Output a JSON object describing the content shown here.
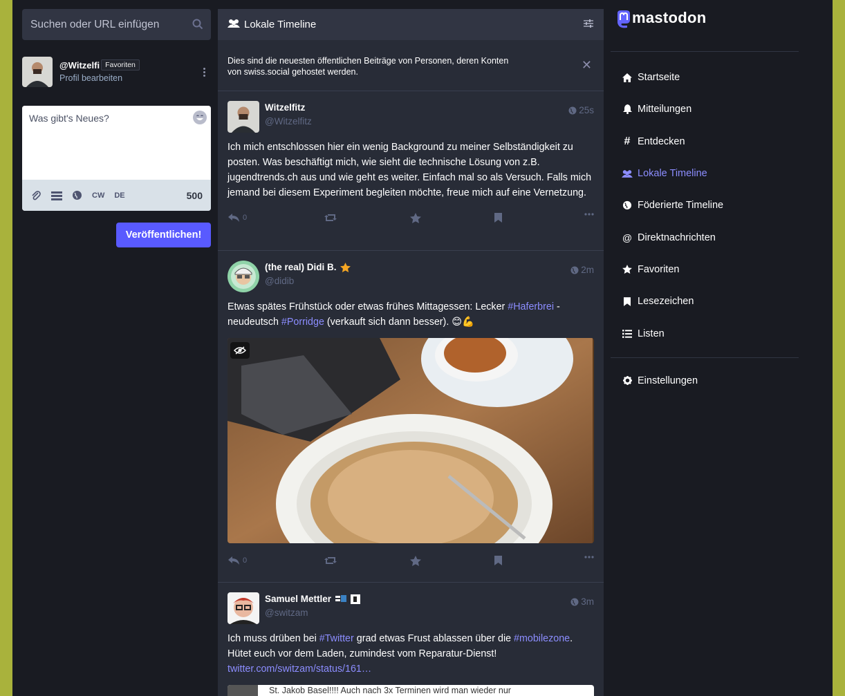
{
  "search": {
    "placeholder": "Suchen oder URL einfügen"
  },
  "profile": {
    "handle": "@Witzelfi",
    "tooltip": "Favoriten",
    "edit_label": "Profil bearbeiten"
  },
  "composer": {
    "placeholder": "Was gibt's Neues?",
    "cw_label": "CW",
    "lang_label": "DE",
    "char_count": "500",
    "publish_label": "Veröffentlichen!"
  },
  "column": {
    "title": "Lokale Timeline",
    "banner_line1": "Dies sind die neuesten öffentlichen Beiträge von Personen, deren Konten",
    "banner_line2": "von swiss.social gehostet werden."
  },
  "posts": [
    {
      "display_name": "Witzelfitz",
      "acct": "@Witzelfitz",
      "time": "25s",
      "text": "Ich mich entschlossen hier ein wenig Background zu meiner Selbständigkeit zu posten. Was beschäftigt mich, wie sieht die technische Lösung von z.B. jugendtrends.ch aus und wie geht es weiter. Einfach mal so als Versuch. Falls mich jemand bei diesem Experiment begleiten möchte, freue mich auf eine Vernetzung.",
      "replies": "0"
    },
    {
      "display_name": "(the real) Didi B.",
      "acct": "@didib",
      "time": "2m",
      "text_a": "Etwas spätes Frühstück oder etwas frühes Mittagessen: Lecker ",
      "tag1": "#Haferbrei",
      "text_b": " - neudeutsch ",
      "tag2": "#Porridge",
      "text_c": " (verkauft sich dann besser). 😊💪",
      "replies": "0"
    },
    {
      "display_name": "Samuel Mettler",
      "acct": "@switzam",
      "time": "3m",
      "text_a": "Ich muss drüben bei ",
      "tag1": "#Twitter",
      "text_b": " grad etwas Frust ablassen über die ",
      "tag2": "#mobilezone",
      "text_c": ". Hütet euch vor dem Laden, zumindest vom Reparatur-Dienst!",
      "link": "twitter.com/switzam/status/161…",
      "preview_text": "St. Jakob Basel!!!! Auch nach 3x Terminen wird man wieder nur"
    }
  ],
  "brand": {
    "logo_text": "mastodon"
  },
  "nav": [
    {
      "label": "Startseite"
    },
    {
      "label": "Mitteilungen"
    },
    {
      "label": "Entdecken"
    },
    {
      "label": "Lokale Timeline"
    },
    {
      "label": "Föderierte Timeline"
    },
    {
      "label": "Direktnachrichten"
    },
    {
      "label": "Favoriten"
    },
    {
      "label": "Lesezeichen"
    },
    {
      "label": "Listen"
    }
  ],
  "settings_nav": {
    "label": "Einstellungen"
  },
  "colors": {
    "accent": "#8c8dff",
    "button": "#595aff",
    "bg": "#191b22",
    "column": "#282c37"
  }
}
